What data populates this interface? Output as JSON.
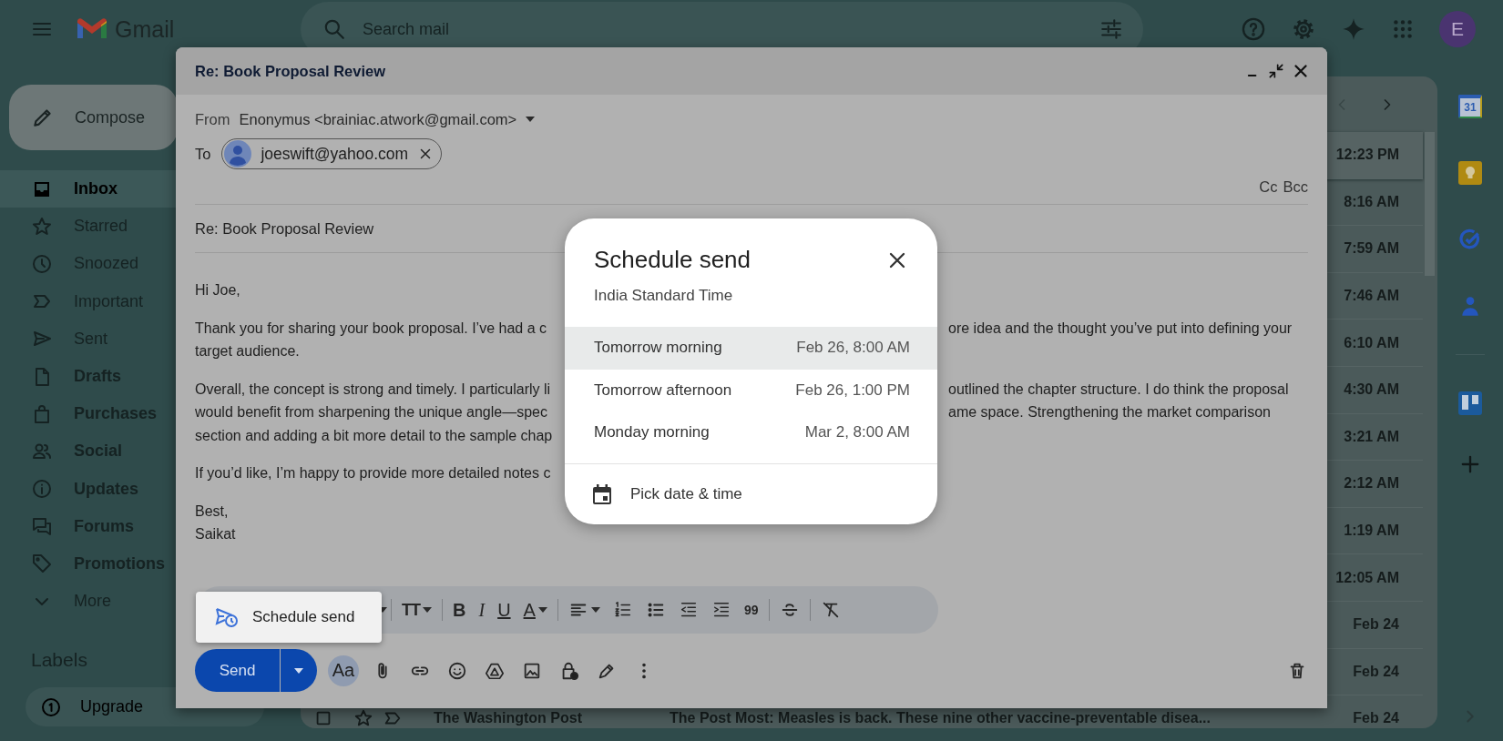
{
  "app": {
    "title": "Gmail",
    "avatar": "E"
  },
  "search": {
    "placeholder": "Search mail"
  },
  "sidebar": {
    "compose": "Compose",
    "items": [
      {
        "label": "Inbox",
        "selected": true,
        "unread": true
      },
      {
        "label": "Starred",
        "selected": false,
        "unread": false
      },
      {
        "label": "Snoozed",
        "selected": false,
        "unread": false
      },
      {
        "label": "Important",
        "selected": false,
        "unread": false
      },
      {
        "label": "Sent",
        "selected": false,
        "unread": false
      },
      {
        "label": "Drafts",
        "selected": false,
        "unread": true
      },
      {
        "label": "Purchases",
        "selected": false,
        "unread": true
      },
      {
        "label": "Social",
        "selected": false,
        "unread": true
      },
      {
        "label": "Updates",
        "selected": false,
        "unread": true
      },
      {
        "label": "Forums",
        "selected": false,
        "unread": true
      },
      {
        "label": "Promotions",
        "selected": false,
        "unread": true
      },
      {
        "label": "More",
        "selected": false,
        "unread": false
      }
    ],
    "labels_title": "Labels",
    "labels": [
      {
        "label": "Upgrade"
      }
    ]
  },
  "mail_list": {
    "rows": [
      {
        "time": "12:23 PM",
        "highlighted": true
      },
      {
        "time": "8:16 AM",
        "highlighted": false
      },
      {
        "time": "7:59 AM",
        "highlighted": false
      },
      {
        "time": "7:46 AM",
        "highlighted": false
      },
      {
        "time": "6:10 AM",
        "highlighted": false
      },
      {
        "time": "4:30 AM",
        "highlighted": false
      },
      {
        "time": "3:21 AM",
        "highlighted": false
      },
      {
        "time": "2:12 AM",
        "highlighted": false
      },
      {
        "time": "1:19 AM",
        "highlighted": false
      },
      {
        "time": "12:05 AM",
        "highlighted": false
      },
      {
        "time": "Feb 24",
        "highlighted": false
      },
      {
        "time": "Feb 24",
        "highlighted": false
      },
      {
        "time": "Feb 24",
        "highlighted": false,
        "sender": "The Washington Post",
        "subject": "The Post Most: Measles is back. These nine other vaccine-preventable disea..."
      }
    ]
  },
  "side_rail": {
    "calendar_day": "31"
  },
  "compose": {
    "title": "Re: Book Proposal Review",
    "from_label": "From",
    "from": "Enonymus <brainiac.atwork@gmail.com>",
    "to_label": "To",
    "recipients": [
      {
        "email": "joeswift@yahoo.com"
      }
    ],
    "cc": "Cc",
    "bcc": "Bcc",
    "subject": "Re: Book Proposal Review",
    "body": [
      {
        "lines": [
          {
            "text": "Hi Joe,"
          }
        ]
      },
      {
        "lines": [
          {
            "text": "Thank you for sharing your book proposal. I’ve had a c",
            "text_right": "ore idea and the thought you’ve put into defining your"
          },
          {
            "text": "target audience."
          }
        ]
      },
      {
        "lines": [
          {
            "text": "Overall, the concept is strong and timely. I particularly li",
            "text_right": "outlined the chapter structure. I do think the proposal"
          },
          {
            "text": "would benefit from sharpening the unique angle—spec",
            "text_right": "ame space. Strengthening the market comparison"
          },
          {
            "text": "section and adding a bit more detail to the sample chap"
          }
        ]
      },
      {
        "lines": [
          {
            "text": "If you’d like, I’m happy to provide more detailed notes c"
          }
        ]
      },
      {
        "lines": [
          {
            "text": "Best,"
          },
          {
            "text": "Saikat"
          }
        ]
      }
    ],
    "format_toolbar": {
      "font_size": "TT",
      "bold": "B",
      "italic": "I",
      "underline": "U",
      "text_color": "A",
      "quote": "99"
    },
    "send": "Send",
    "text_format": "Aa",
    "schedule_menu": {
      "label": "Schedule send"
    }
  },
  "schedule_dialog": {
    "title": "Schedule send",
    "timezone": "India Standard Time",
    "options": [
      {
        "label": "Tomorrow morning",
        "time": "Feb 26, 8:00 AM",
        "selected": true
      },
      {
        "label": "Tomorrow afternoon",
        "time": "Feb 26, 1:00 PM",
        "selected": false
      },
      {
        "label": "Monday morning",
        "time": "Mar 2, 8:00 AM",
        "selected": false
      }
    ],
    "custom": "Pick date & time"
  }
}
